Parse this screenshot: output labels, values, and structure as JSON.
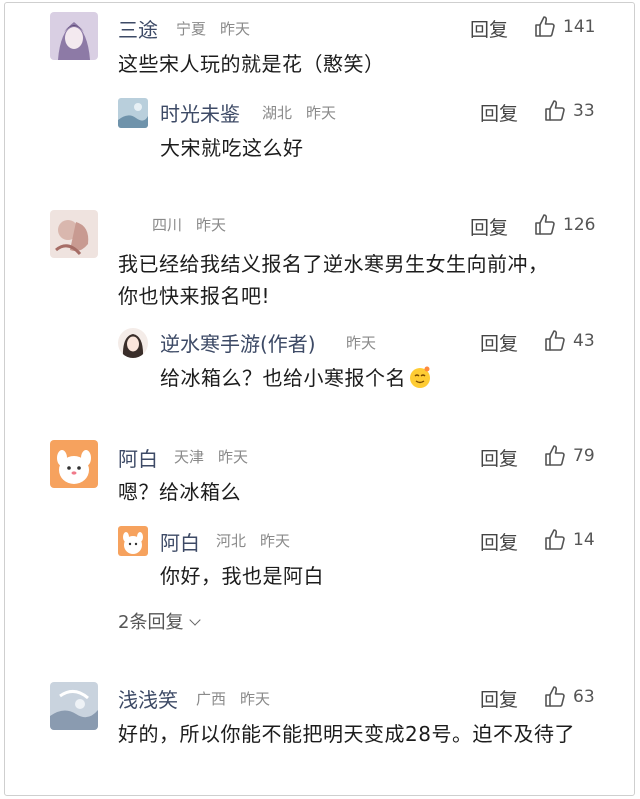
{
  "actions": {
    "reply_label": "回复",
    "more_replies_label": "2条回复"
  },
  "comments": [
    {
      "user": "三途",
      "region": "宁夏",
      "time": "昨天",
      "likes": "141",
      "text": "这些宋人玩的就是花（憨笑）",
      "reply": {
        "user": "时光未鉴",
        "region": "湖北",
        "time": "昨天",
        "likes": "33",
        "text": "大宋就吃这么好"
      }
    },
    {
      "user": "",
      "region": "四川",
      "time": "昨天",
      "likes": "126",
      "text": "我已经给我结义报名了逆水寒男生女生向前冲，你也快来报名吧!",
      "reply": {
        "user": "逆水寒手游(作者)",
        "time": "昨天",
        "likes": "43",
        "text": "给冰箱么？也给小寒报个名"
      }
    },
    {
      "user": "阿白",
      "region": "天津",
      "time": "昨天",
      "likes": "79",
      "text": "嗯？给冰箱么",
      "reply": {
        "user": "阿白",
        "region": "河北",
        "time": "昨天",
        "likes": "14",
        "text": "你好，我也是阿白"
      }
    },
    {
      "user": "浅浅笑",
      "region": "广西",
      "time": "昨天",
      "likes": "63",
      "text": "好的，所以你能不能把明天变成28号。迫不及待了"
    }
  ],
  "icons": {
    "like": "thumbs-up-icon",
    "chevron": "chevron-down-icon",
    "emoji": "smiling-emoji-icon"
  },
  "colors": {
    "username": "#3d4a66",
    "meta": "#8a8a8a",
    "text": "#1c1c1c"
  }
}
